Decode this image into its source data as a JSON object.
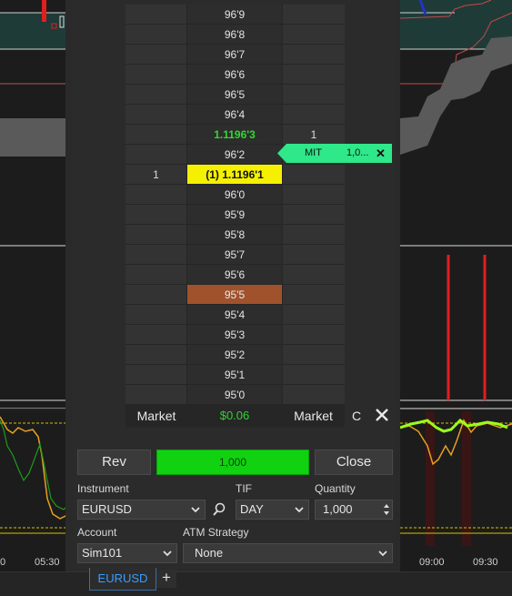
{
  "ladder": {
    "rows": [
      {
        "bid": "",
        "price": "96'9",
        "ask": "",
        "style": "normal"
      },
      {
        "bid": "",
        "price": "96'8",
        "ask": "",
        "style": "normal"
      },
      {
        "bid": "",
        "price": "96'7",
        "ask": "",
        "style": "normal"
      },
      {
        "bid": "",
        "price": "96'6",
        "ask": "",
        "style": "normal"
      },
      {
        "bid": "",
        "price": "96'5",
        "ask": "",
        "style": "normal"
      },
      {
        "bid": "",
        "price": "96'4",
        "ask": "",
        "style": "normal"
      },
      {
        "bid": "",
        "price": "1.1196'3",
        "ask": "1",
        "style": "last"
      },
      {
        "bid": "",
        "price": "96'2",
        "ask": "",
        "style": "normal"
      },
      {
        "bid": "1",
        "price": "(1) 1.1196'1",
        "ask": "",
        "style": "current"
      },
      {
        "bid": "",
        "price": "96'0",
        "ask": "",
        "style": "normal"
      },
      {
        "bid": "",
        "price": "95'9",
        "ask": "",
        "style": "normal"
      },
      {
        "bid": "",
        "price": "95'8",
        "ask": "",
        "style": "normal"
      },
      {
        "bid": "",
        "price": "95'7",
        "ask": "",
        "style": "normal"
      },
      {
        "bid": "",
        "price": "95'6",
        "ask": "",
        "style": "normal"
      },
      {
        "bid": "",
        "price": "95'5",
        "ask": "",
        "style": "marker"
      },
      {
        "bid": "",
        "price": "95'4",
        "ask": "",
        "style": "normal"
      },
      {
        "bid": "",
        "price": "95'3",
        "ask": "",
        "style": "normal"
      },
      {
        "bid": "",
        "price": "95'2",
        "ask": "",
        "style": "normal"
      },
      {
        "bid": "",
        "price": "95'1",
        "ask": "",
        "style": "normal"
      },
      {
        "bid": "",
        "price": "95'0",
        "ask": "",
        "style": "normal"
      }
    ],
    "footer": {
      "left": "Market",
      "pnl": "$0.06",
      "right": "Market"
    },
    "c_label": "C"
  },
  "order_tag": {
    "type": "MIT",
    "qty": "1,0..."
  },
  "buttons": {
    "rev": "Rev",
    "quantity": "1,000",
    "close": "Close"
  },
  "form": {
    "instrument_label": "Instrument",
    "instrument_value": "EURUSD",
    "tif_label": "TIF",
    "tif_value": "DAY",
    "quantity_label": "Quantity",
    "quantity_value": "1,000",
    "account_label": "Account",
    "account_value": "Sim101",
    "atm_label": "ATM Strategy",
    "atm_value": "None"
  },
  "left_chart": {
    "time_labels": [
      "0",
      "05:30"
    ]
  },
  "right_chart": {
    "time_labels": [
      "09:00",
      "09:30"
    ]
  },
  "tabs": {
    "active": "EURUSD",
    "add": "+"
  },
  "colors": {
    "last_price": "#31d831",
    "current_price_bg": "#f5f000",
    "marker_bg": "#a0522d",
    "qty_button": "#10d210",
    "tag": "#2ee88a",
    "tab_text": "#3a9cff"
  }
}
